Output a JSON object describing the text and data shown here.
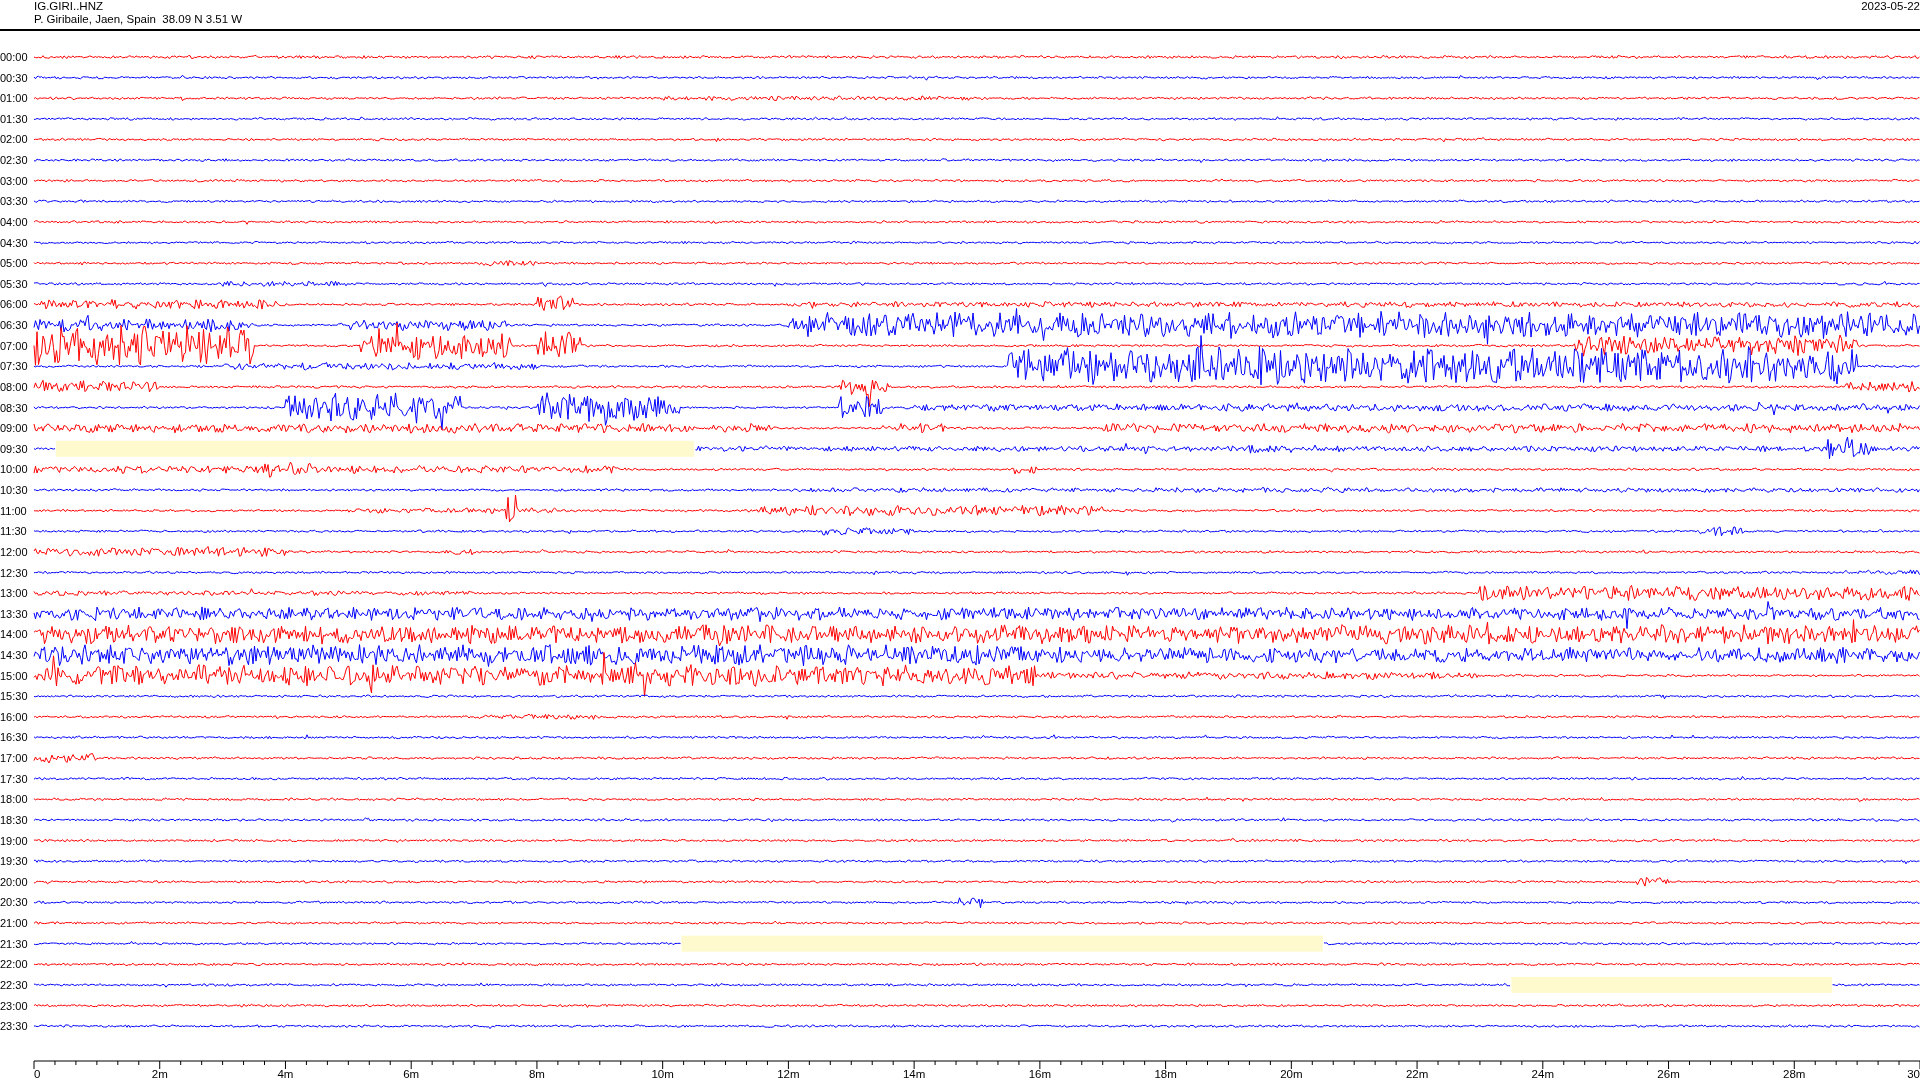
{
  "header": {
    "station": "IG.GIRI..HNZ",
    "location": "P. Giribaile, Jaen, Spain  38.09 N 3.51 W",
    "date": "2023-05-22"
  },
  "traces": [
    {
      "label": "00:00",
      "color": "#ff0000",
      "gap": false
    },
    {
      "label": "00:30",
      "color": "#0000ff",
      "gap": false
    },
    {
      "label": "01:00",
      "color": "#ff0000",
      "gap": false
    },
    {
      "label": "01:30",
      "color": "#0000ff",
      "gap": false
    },
    {
      "label": "02:00",
      "color": "#ff0000",
      "gap": false
    },
    {
      "label": "02:30",
      "color": "#0000ff",
      "gap": false
    },
    {
      "label": "03:00",
      "color": "#ff0000",
      "gap": false
    },
    {
      "label": "03:30",
      "color": "#0000ff",
      "gap": false
    },
    {
      "label": "04:00",
      "color": "#ff0000",
      "gap": false
    },
    {
      "label": "04:30",
      "color": "#0000ff",
      "gap": false
    },
    {
      "label": "05:00",
      "color": "#ff0000",
      "gap": false
    },
    {
      "label": "05:30",
      "color": "#0000ff",
      "gap": false
    },
    {
      "label": "06:00",
      "color": "#ff0000",
      "gap": false
    },
    {
      "label": "06:30",
      "color": "#0000ff",
      "gap": false
    },
    {
      "label": "07:00",
      "color": "#ff0000",
      "gap": false
    },
    {
      "label": "07:30",
      "color": "#0000ff",
      "gap": false
    },
    {
      "label": "08:00",
      "color": "#ff0000",
      "gap": false
    },
    {
      "label": "08:30",
      "color": "#0000ff",
      "gap": false
    },
    {
      "label": "09:00",
      "color": "#ff0000",
      "gap": false
    },
    {
      "label": "09:30",
      "color": "#0000ff",
      "gap": true
    },
    {
      "label": "10:00",
      "color": "#ff0000",
      "gap": false
    },
    {
      "label": "10:30",
      "color": "#0000ff",
      "gap": false
    },
    {
      "label": "11:00",
      "color": "#ff0000",
      "gap": false
    },
    {
      "label": "11:30",
      "color": "#0000ff",
      "gap": false
    },
    {
      "label": "12:00",
      "color": "#ff0000",
      "gap": false
    },
    {
      "label": "12:30",
      "color": "#0000ff",
      "gap": false
    },
    {
      "label": "13:00",
      "color": "#ff0000",
      "gap": false
    },
    {
      "label": "13:30",
      "color": "#0000ff",
      "gap": false
    },
    {
      "label": "14:00",
      "color": "#ff0000",
      "gap": false
    },
    {
      "label": "14:30",
      "color": "#0000ff",
      "gap": false
    },
    {
      "label": "15:00",
      "color": "#ff0000",
      "gap": false
    },
    {
      "label": "15:30",
      "color": "#0000ff",
      "gap": false
    },
    {
      "label": "16:00",
      "color": "#ff0000",
      "gap": false
    },
    {
      "label": "16:30",
      "color": "#0000ff",
      "gap": false
    },
    {
      "label": "17:00",
      "color": "#ff0000",
      "gap": false
    },
    {
      "label": "17:30",
      "color": "#0000ff",
      "gap": false
    },
    {
      "label": "18:00",
      "color": "#ff0000",
      "gap": false
    },
    {
      "label": "18:30",
      "color": "#0000ff",
      "gap": false
    },
    {
      "label": "19:00",
      "color": "#ff0000",
      "gap": false
    },
    {
      "label": "19:30",
      "color": "#0000ff",
      "gap": false
    },
    {
      "label": "20:00",
      "color": "#ff0000",
      "gap": false
    },
    {
      "label": "20:30",
      "color": "#0000ff",
      "gap": false
    },
    {
      "label": "21:00",
      "color": "#ff0000",
      "gap": false
    },
    {
      "label": "21:30",
      "color": "#0000ff",
      "gap": true
    },
    {
      "label": "22:00",
      "color": "#ff0000",
      "gap": false
    },
    {
      "label": "22:30",
      "color": "#0000ff",
      "gap": true
    },
    {
      "label": "23:00",
      "color": "#ff0000",
      "gap": false
    },
    {
      "label": "23:30",
      "color": "#0000ff",
      "gap": false
    }
  ],
  "axis": {
    "labels": [
      "0",
      "2m",
      "4m",
      "6m",
      "8m",
      "10m",
      "12m",
      "14m",
      "16m",
      "18m",
      "20m",
      "22m",
      "24m",
      "26m",
      "28m",
      "30"
    ]
  }
}
